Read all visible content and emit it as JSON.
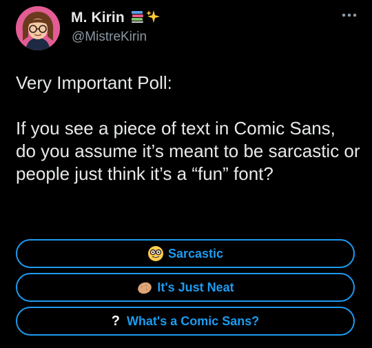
{
  "colors": {
    "background": "#000000",
    "text": "#e7e9ea",
    "secondary_text": "#8b98a5",
    "accent": "#1d9bf0"
  },
  "author": {
    "display_name": "M. Kirin",
    "handle": "@MistreKirin",
    "name_emoji": [
      "books-icon",
      "sparkles-icon"
    ]
  },
  "tweet": {
    "text": "Very Important Poll:\n\nIf you see a piece of text in Comic Sans, do you assume it’s meant to be sarcastic or people just think it’s a “fun” font?"
  },
  "poll": {
    "options": [
      {
        "icon": "nerd-face-icon",
        "label": "Sarcastic"
      },
      {
        "icon": "potato-icon",
        "label": "It's Just Neat"
      },
      {
        "icon": "question-mark-icon",
        "label": "What's a Comic Sans?"
      }
    ]
  }
}
